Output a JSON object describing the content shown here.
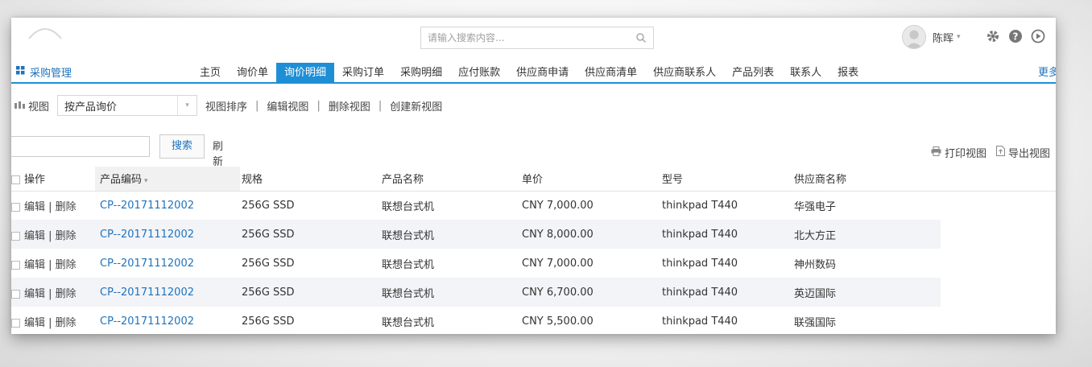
{
  "header": {
    "search_placeholder": "请输入搜索内容...",
    "user_name": "陈晖"
  },
  "nav": {
    "module_label": "采购管理",
    "tabs": [
      {
        "label": "主页"
      },
      {
        "label": "询价单"
      },
      {
        "label": "询价明细",
        "active": true
      },
      {
        "label": "采购订单"
      },
      {
        "label": "采购明细"
      },
      {
        "label": "应付账款"
      },
      {
        "label": "供应商申请"
      },
      {
        "label": "供应商清单"
      },
      {
        "label": "供应商联系人"
      },
      {
        "label": "产品列表"
      },
      {
        "label": "联系人"
      },
      {
        "label": "报表"
      }
    ],
    "more_label": "更多",
    "active_color": "#1e8fd6"
  },
  "viewbar": {
    "view_label": "视图",
    "selected_view": "按产品询价",
    "sort_view": "视图排序",
    "edit_view": "编辑视图",
    "delete_view": "删除视图",
    "create_view": "创建新视图"
  },
  "searchrow": {
    "search_value": "",
    "search_button": "搜索",
    "refresh": "刷新",
    "print_view": "打印视图",
    "export_view": "导出视图"
  },
  "table": {
    "headers": {
      "ops": "操作",
      "code": "产品编码",
      "spec": "规格",
      "name": "产品名称",
      "price": "单价",
      "model": "型号",
      "supplier": "供应商名称"
    },
    "edit_label": "编辑",
    "delete_label": "删除",
    "rows": [
      {
        "code": "CP--20171112002",
        "spec": "256G SSD",
        "name": "联想台式机",
        "price": "CNY 7,000.00",
        "model": "thinkpad T440",
        "supplier": "华强电子"
      },
      {
        "code": "CP--20171112002",
        "spec": "256G SSD",
        "name": "联想台式机",
        "price": "CNY 8,000.00",
        "model": "thinkpad T440",
        "supplier": "北大方正"
      },
      {
        "code": "CP--20171112002",
        "spec": "256G SSD",
        "name": "联想台式机",
        "price": "CNY 7,000.00",
        "model": "thinkpad T440",
        "supplier": "神州数码"
      },
      {
        "code": "CP--20171112002",
        "spec": "256G SSD",
        "name": "联想台式机",
        "price": "CNY 6,700.00",
        "model": "thinkpad T440",
        "supplier": "英迈国际"
      },
      {
        "code": "CP--20171112002",
        "spec": "256G SSD",
        "name": "联想台式机",
        "price": "CNY 5,500.00",
        "model": "thinkpad T440",
        "supplier": "联强国际"
      }
    ]
  }
}
